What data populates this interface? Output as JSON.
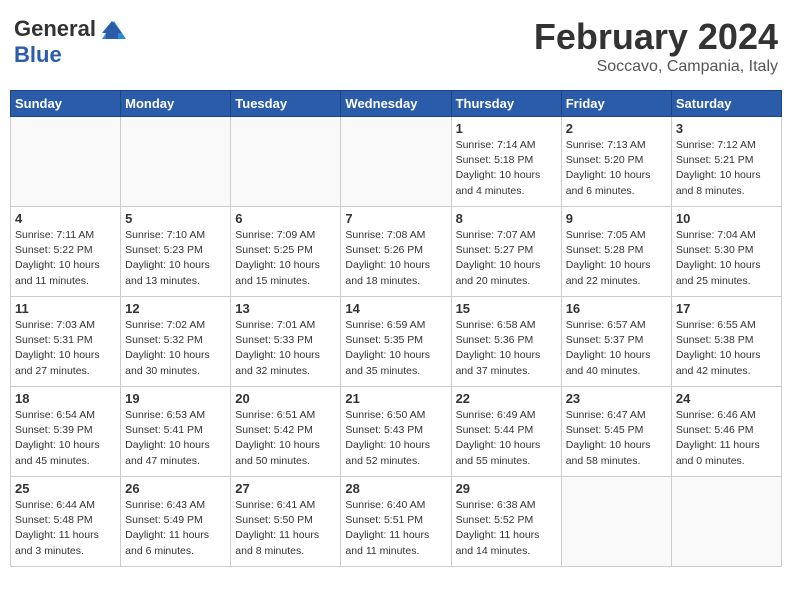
{
  "header": {
    "logo_text_1": "General",
    "logo_text_2": "Blue",
    "title": "February 2024",
    "subtitle": "Soccavo, Campania, Italy"
  },
  "days_of_week": [
    "Sunday",
    "Monday",
    "Tuesday",
    "Wednesday",
    "Thursday",
    "Friday",
    "Saturday"
  ],
  "weeks": [
    [
      {
        "num": "",
        "info": ""
      },
      {
        "num": "",
        "info": ""
      },
      {
        "num": "",
        "info": ""
      },
      {
        "num": "",
        "info": ""
      },
      {
        "num": "1",
        "info": "Sunrise: 7:14 AM\nSunset: 5:18 PM\nDaylight: 10 hours\nand 4 minutes."
      },
      {
        "num": "2",
        "info": "Sunrise: 7:13 AM\nSunset: 5:20 PM\nDaylight: 10 hours\nand 6 minutes."
      },
      {
        "num": "3",
        "info": "Sunrise: 7:12 AM\nSunset: 5:21 PM\nDaylight: 10 hours\nand 8 minutes."
      }
    ],
    [
      {
        "num": "4",
        "info": "Sunrise: 7:11 AM\nSunset: 5:22 PM\nDaylight: 10 hours\nand 11 minutes."
      },
      {
        "num": "5",
        "info": "Sunrise: 7:10 AM\nSunset: 5:23 PM\nDaylight: 10 hours\nand 13 minutes."
      },
      {
        "num": "6",
        "info": "Sunrise: 7:09 AM\nSunset: 5:25 PM\nDaylight: 10 hours\nand 15 minutes."
      },
      {
        "num": "7",
        "info": "Sunrise: 7:08 AM\nSunset: 5:26 PM\nDaylight: 10 hours\nand 18 minutes."
      },
      {
        "num": "8",
        "info": "Sunrise: 7:07 AM\nSunset: 5:27 PM\nDaylight: 10 hours\nand 20 minutes."
      },
      {
        "num": "9",
        "info": "Sunrise: 7:05 AM\nSunset: 5:28 PM\nDaylight: 10 hours\nand 22 minutes."
      },
      {
        "num": "10",
        "info": "Sunrise: 7:04 AM\nSunset: 5:30 PM\nDaylight: 10 hours\nand 25 minutes."
      }
    ],
    [
      {
        "num": "11",
        "info": "Sunrise: 7:03 AM\nSunset: 5:31 PM\nDaylight: 10 hours\nand 27 minutes."
      },
      {
        "num": "12",
        "info": "Sunrise: 7:02 AM\nSunset: 5:32 PM\nDaylight: 10 hours\nand 30 minutes."
      },
      {
        "num": "13",
        "info": "Sunrise: 7:01 AM\nSunset: 5:33 PM\nDaylight: 10 hours\nand 32 minutes."
      },
      {
        "num": "14",
        "info": "Sunrise: 6:59 AM\nSunset: 5:35 PM\nDaylight: 10 hours\nand 35 minutes."
      },
      {
        "num": "15",
        "info": "Sunrise: 6:58 AM\nSunset: 5:36 PM\nDaylight: 10 hours\nand 37 minutes."
      },
      {
        "num": "16",
        "info": "Sunrise: 6:57 AM\nSunset: 5:37 PM\nDaylight: 10 hours\nand 40 minutes."
      },
      {
        "num": "17",
        "info": "Sunrise: 6:55 AM\nSunset: 5:38 PM\nDaylight: 10 hours\nand 42 minutes."
      }
    ],
    [
      {
        "num": "18",
        "info": "Sunrise: 6:54 AM\nSunset: 5:39 PM\nDaylight: 10 hours\nand 45 minutes."
      },
      {
        "num": "19",
        "info": "Sunrise: 6:53 AM\nSunset: 5:41 PM\nDaylight: 10 hours\nand 47 minutes."
      },
      {
        "num": "20",
        "info": "Sunrise: 6:51 AM\nSunset: 5:42 PM\nDaylight: 10 hours\nand 50 minutes."
      },
      {
        "num": "21",
        "info": "Sunrise: 6:50 AM\nSunset: 5:43 PM\nDaylight: 10 hours\nand 52 minutes."
      },
      {
        "num": "22",
        "info": "Sunrise: 6:49 AM\nSunset: 5:44 PM\nDaylight: 10 hours\nand 55 minutes."
      },
      {
        "num": "23",
        "info": "Sunrise: 6:47 AM\nSunset: 5:45 PM\nDaylight: 10 hours\nand 58 minutes."
      },
      {
        "num": "24",
        "info": "Sunrise: 6:46 AM\nSunset: 5:46 PM\nDaylight: 11 hours\nand 0 minutes."
      }
    ],
    [
      {
        "num": "25",
        "info": "Sunrise: 6:44 AM\nSunset: 5:48 PM\nDaylight: 11 hours\nand 3 minutes."
      },
      {
        "num": "26",
        "info": "Sunrise: 6:43 AM\nSunset: 5:49 PM\nDaylight: 11 hours\nand 6 minutes."
      },
      {
        "num": "27",
        "info": "Sunrise: 6:41 AM\nSunset: 5:50 PM\nDaylight: 11 hours\nand 8 minutes."
      },
      {
        "num": "28",
        "info": "Sunrise: 6:40 AM\nSunset: 5:51 PM\nDaylight: 11 hours\nand 11 minutes."
      },
      {
        "num": "29",
        "info": "Sunrise: 6:38 AM\nSunset: 5:52 PM\nDaylight: 11 hours\nand 14 minutes."
      },
      {
        "num": "",
        "info": ""
      },
      {
        "num": "",
        "info": ""
      }
    ]
  ]
}
